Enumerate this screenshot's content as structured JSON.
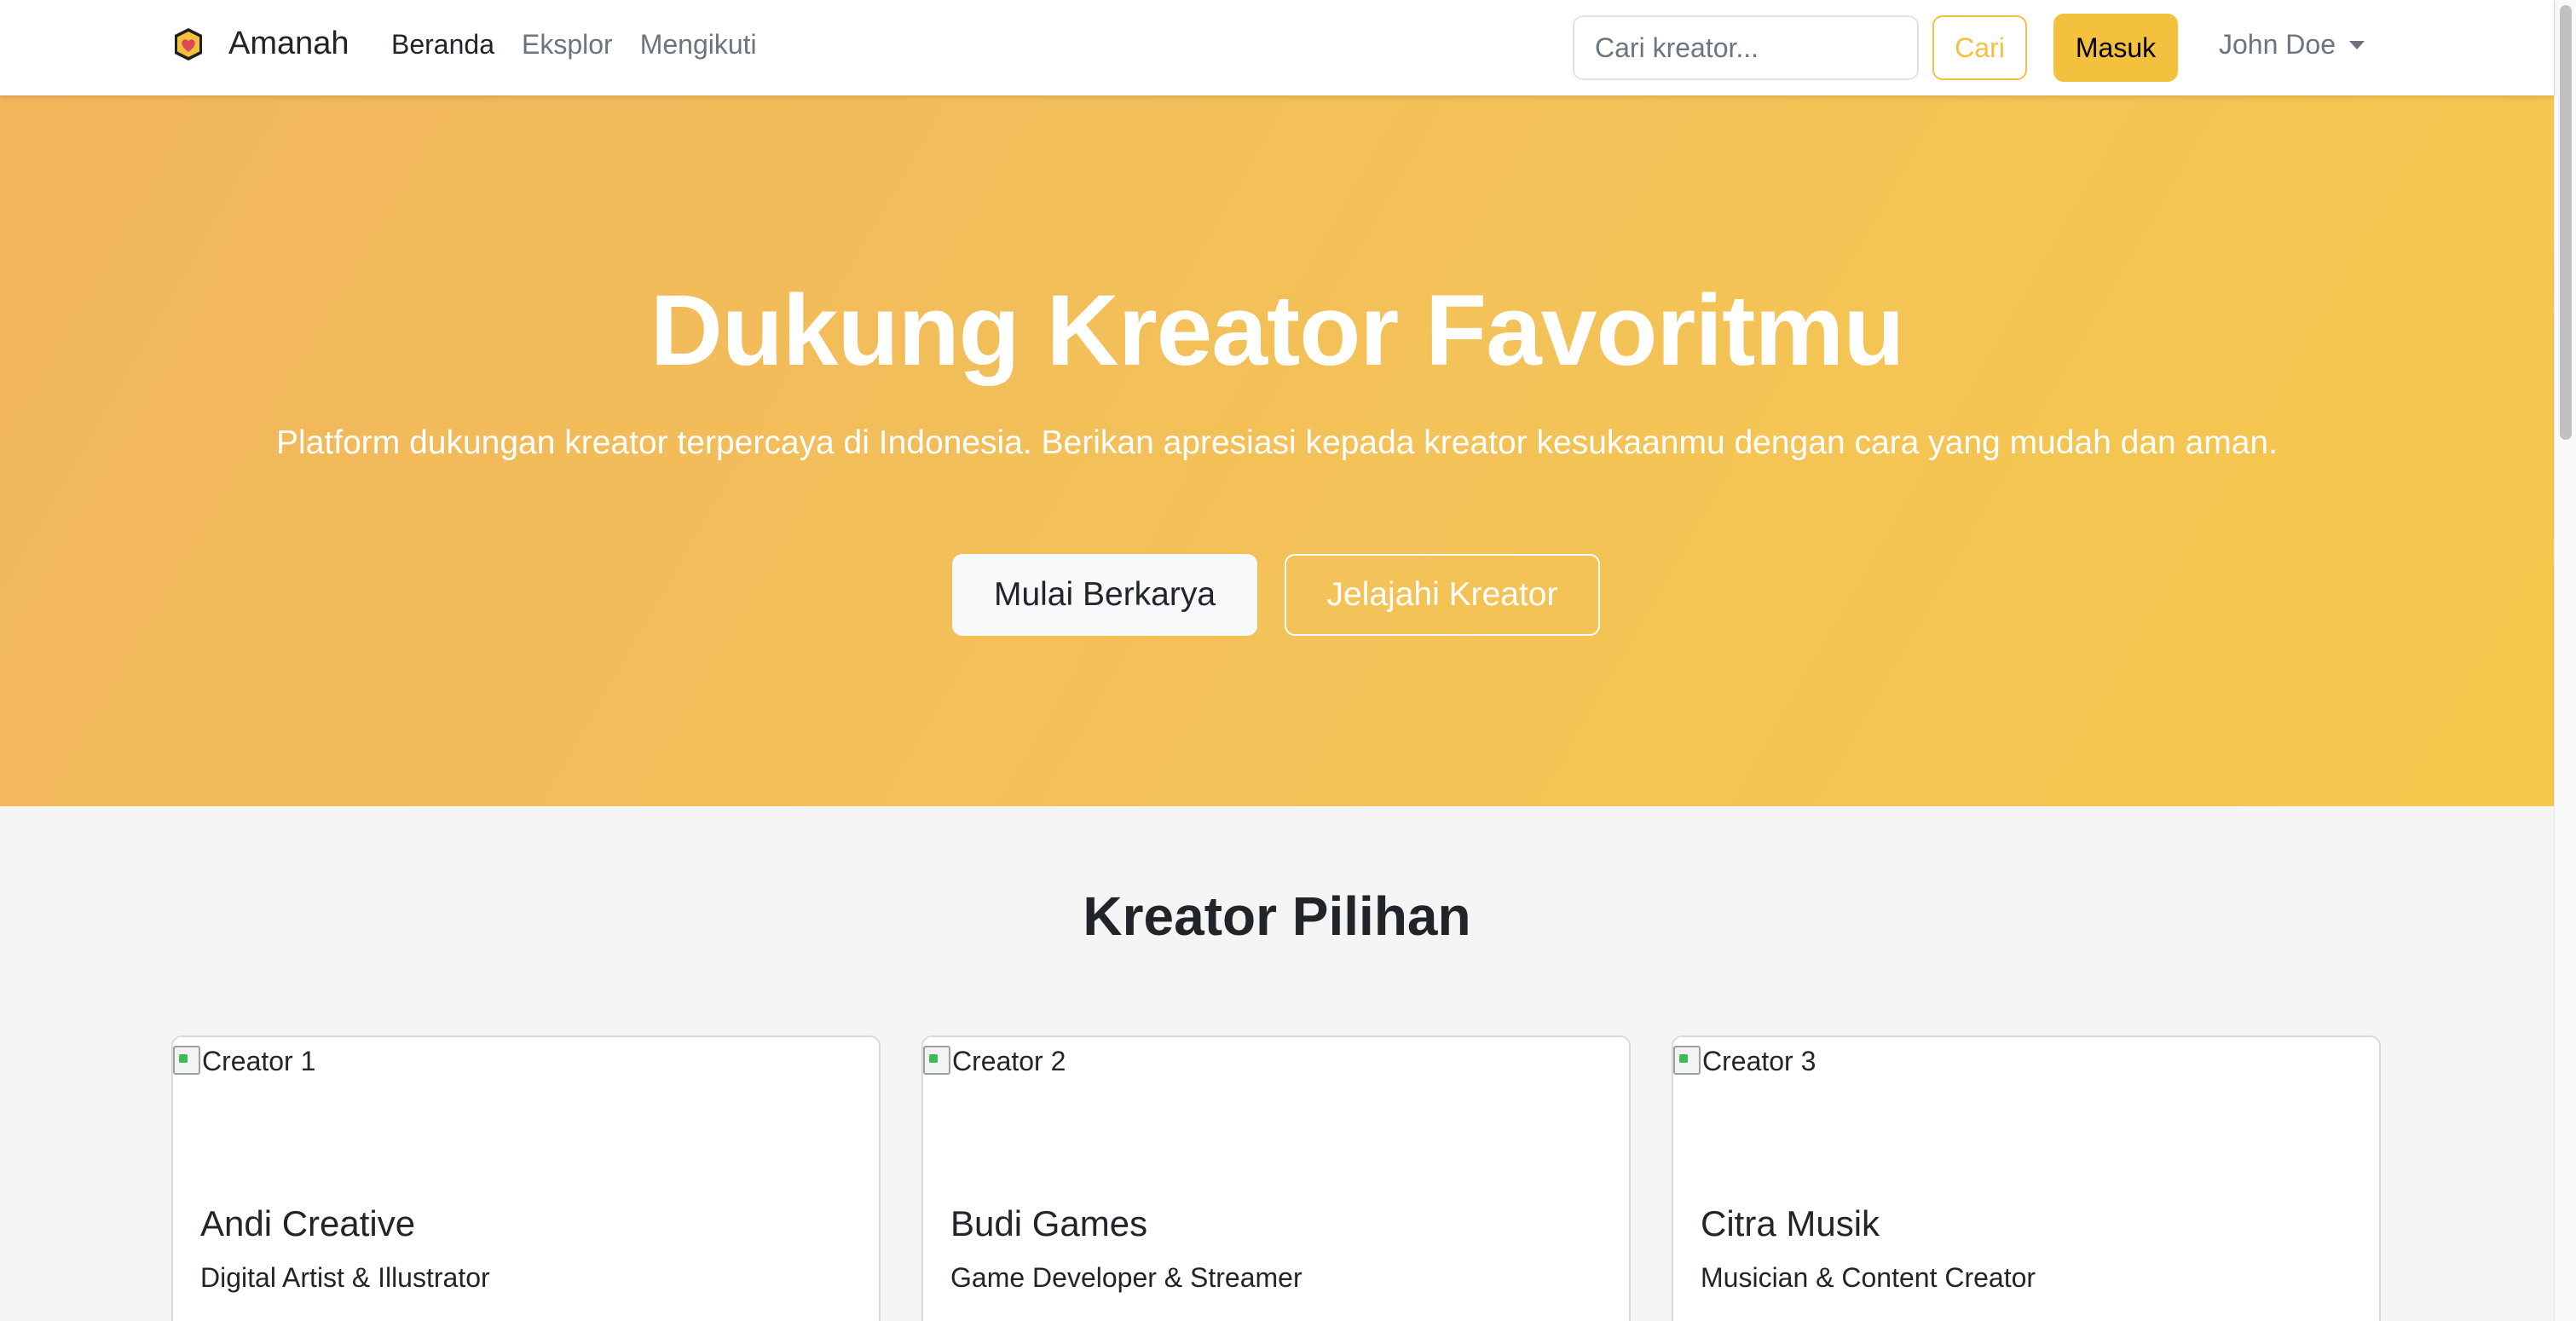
{
  "navbar": {
    "brand": "Amanah",
    "links": [
      {
        "label": "Beranda",
        "active": true
      },
      {
        "label": "Eksplor",
        "active": false
      },
      {
        "label": "Mengikuti",
        "active": false
      }
    ],
    "search": {
      "placeholder": "Cari kreator...",
      "value": ""
    },
    "search_button": "Cari",
    "login_button": "Masuk",
    "user_name": "John Doe"
  },
  "hero": {
    "title": "Dukung Kreator Favoritmu",
    "subtitle": "Platform dukungan kreator terpercaya di Indonesia. Berikan apresiasi kepada kreator kesukaanmu dengan cara yang mudah dan aman.",
    "primary_button": "Mulai Berkarya",
    "secondary_button": "Jelajahi Kreator"
  },
  "featured": {
    "title": "Kreator Pilihan",
    "creators": [
      {
        "image_alt": "Creator 1",
        "name": "Andi Creative",
        "role": "Digital Artist & Illustrator"
      },
      {
        "image_alt": "Creator 2",
        "name": "Budi Games",
        "role": "Game Developer & Streamer"
      },
      {
        "image_alt": "Creator 3",
        "name": "Citra Musik",
        "role": "Musician & Content Creator"
      }
    ]
  },
  "colors": {
    "accent": "#f4c13e",
    "hero_gradient_start": "#f1b55c",
    "hero_gradient_end": "#f5c84c"
  },
  "icons": [
    "heart-shield-logo-icon",
    "caret-down-icon",
    "broken-image-icon"
  ]
}
